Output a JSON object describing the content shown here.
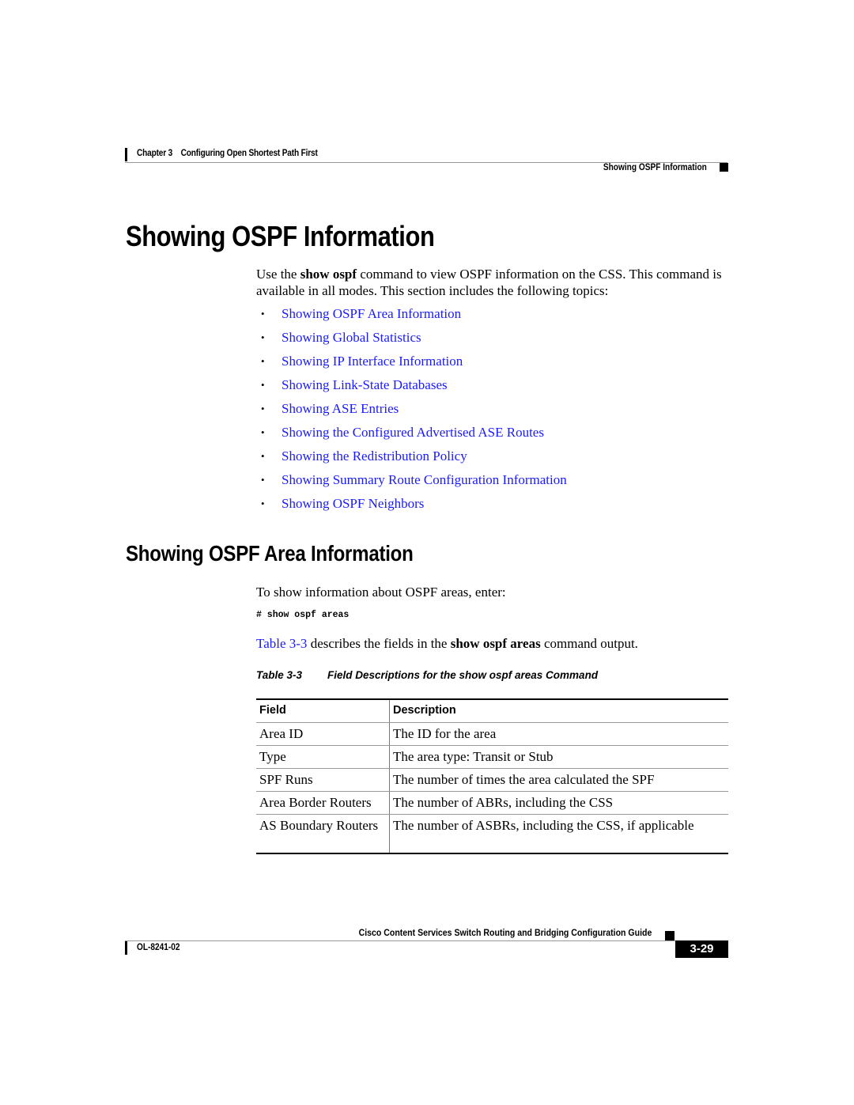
{
  "header": {
    "chapter": "Chapter 3    Configuring Open Shortest Path First",
    "section": "Showing OSPF Information"
  },
  "main": {
    "title": "Showing OSPF Information",
    "intro": {
      "before": "Use the ",
      "command": "show ospf",
      "after": " command to view OSPF information on the CSS. This command is available in all modes. This section includes the following topics:"
    },
    "bullet_glyph": "•",
    "topics": [
      "Showing OSPF Area Information",
      "Showing Global Statistics",
      "Showing IP Interface Information",
      "Showing Link-State Databases",
      "Showing ASE Entries",
      "Showing the Configured Advertised ASE Routes",
      "Showing the Redistribution Policy",
      "Showing Summary Route Configuration Information",
      "Showing OSPF Neighbors"
    ],
    "link_color": "#1a1aff"
  },
  "area_section": {
    "title": "Showing OSPF Area Information",
    "intro": "To show information about OSPF areas, enter:",
    "code": "# show ospf areas",
    "table_ref": {
      "link": "Table 3-3",
      "before": " describes the fields in the ",
      "command": "show ospf areas",
      "after": " command output."
    },
    "caption": {
      "number": "Table 3-3",
      "text": "Field Descriptions for the show ospf areas Command"
    },
    "table": {
      "headers": [
        "Field",
        "Description"
      ],
      "rows": [
        [
          "Area ID",
          "The ID for the area"
        ],
        [
          "Type",
          "The area type: Transit or Stub"
        ],
        [
          "SPF Runs",
          "The number of times the area calculated the SPF"
        ],
        [
          "Area Border Routers",
          "The number of ABRs, including the CSS"
        ],
        [
          "AS Boundary Routers",
          "The number of ASBRs, including the CSS, if applicable"
        ]
      ]
    }
  },
  "footer": {
    "guide_title": "Cisco Content Services Switch Routing and Bridging Configuration Guide",
    "doc_number": "OL-8241-02",
    "page": "3-29"
  }
}
